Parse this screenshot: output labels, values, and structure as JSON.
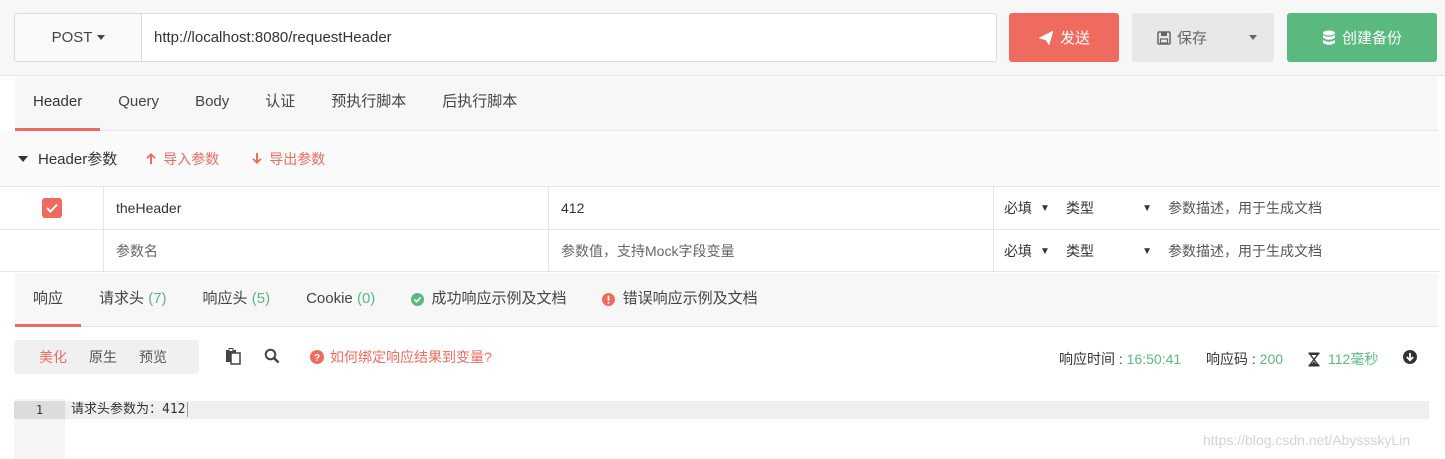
{
  "request": {
    "method": "POST",
    "url": "http://localhost:8080/requestHeader",
    "send_label": "发送",
    "save_label": "保存",
    "backup_label": "创建备份"
  },
  "req_tabs": [
    "Header",
    "Query",
    "Body",
    "认证",
    "预执行脚本",
    "后执行脚本"
  ],
  "header_section": {
    "title": "Header参数",
    "import_label": "导入参数",
    "export_label": "导出参数"
  },
  "params": {
    "row1": {
      "checked": true,
      "key": "theHeader",
      "value": "412",
      "required": "必填",
      "type": "类型",
      "desc_placeholder": "参数描述，用于生成文档"
    },
    "row2": {
      "key_placeholder": "参数名",
      "value_placeholder": "参数值，支持Mock字段变量",
      "required": "必填",
      "type": "类型",
      "desc_placeholder": "参数描述，用于生成文档"
    }
  },
  "resp_tabs": {
    "response": "响应",
    "req_headers": "请求头",
    "req_headers_count": "(7)",
    "resp_headers": "响应头",
    "resp_headers_count": "(5)",
    "cookie": "Cookie",
    "cookie_count": "(0)",
    "success_doc": "成功响应示例及文档",
    "error_doc": "错误响应示例及文档"
  },
  "toolbar": {
    "beautify": "美化",
    "raw": "原生",
    "preview": "预览",
    "help": "如何绑定响应结果到变量?",
    "time_label": "响应时间 :",
    "time_value": "16:50:41",
    "code_label": "响应码 :",
    "code_value": "200",
    "duration": "112毫秒"
  },
  "editor": {
    "line_number": "1",
    "line_text": "请求头参数为：412"
  },
  "watermark": "https://blog.csdn.net/AbyssskyLin",
  "colors": {
    "accent_red": "#ef6b5f",
    "accent_green": "#5ab97f"
  }
}
